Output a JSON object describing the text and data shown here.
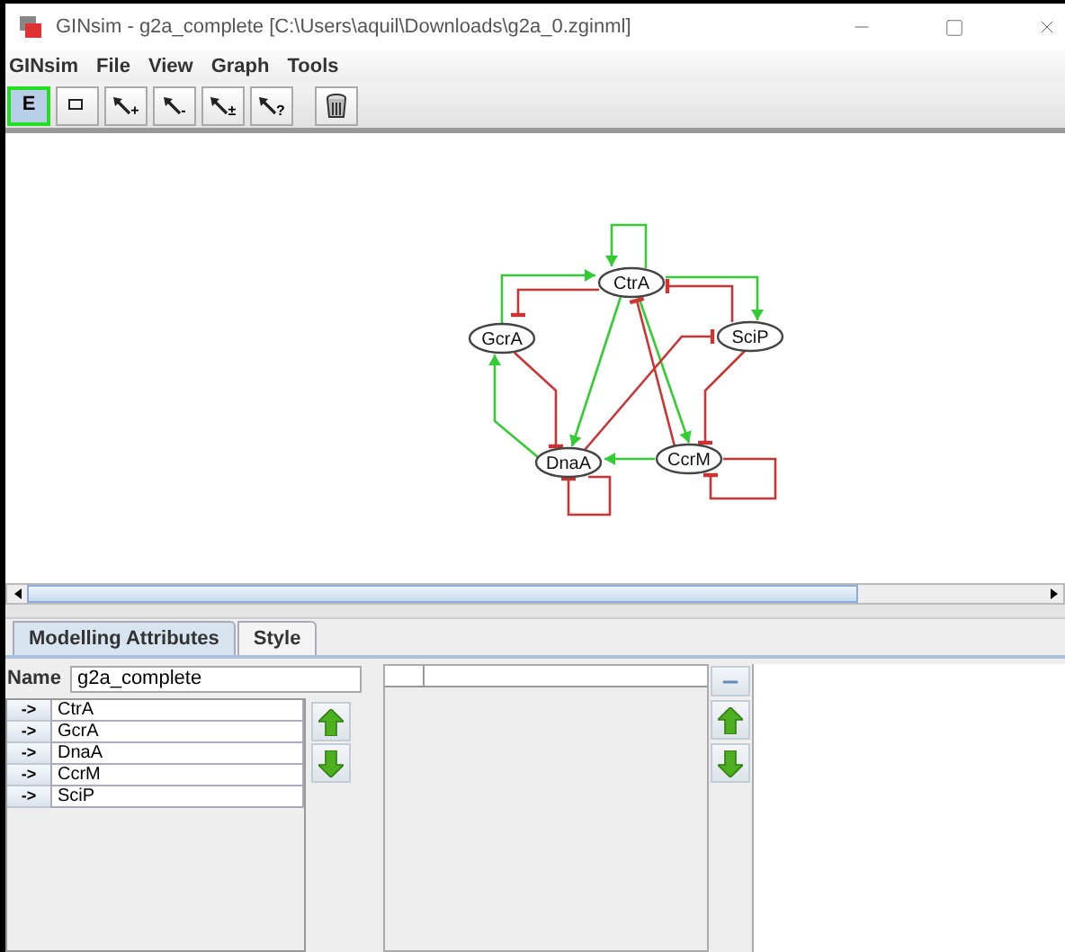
{
  "window": {
    "title": "GINsim - g2a_complete [C:\\Users\\aquil\\Downloads\\g2a_0.zginml]"
  },
  "menu": [
    "GINsim",
    "File",
    "View",
    "Graph",
    "Tools"
  ],
  "toolbar": [
    {
      "kind": "text",
      "label": "E",
      "selected": true
    },
    {
      "kind": "add-node",
      "selected": false
    },
    {
      "kind": "edge",
      "sub": "+",
      "selected": false
    },
    {
      "kind": "edge",
      "sub": "-",
      "selected": false
    },
    {
      "kind": "edge",
      "sub": "±",
      "selected": false
    },
    {
      "kind": "edge",
      "sub": "?",
      "selected": false
    },
    {
      "kind": "delete",
      "selected": false
    }
  ],
  "graph": {
    "nodes": [
      {
        "label": "CtrA"
      },
      {
        "label": "GcrA"
      },
      {
        "label": "SciP"
      },
      {
        "label": "DnaA"
      },
      {
        "label": "CcrM"
      }
    ],
    "edges": [
      {
        "kind": "activation"
      },
      {
        "kind": "activation"
      },
      {
        "kind": "activation"
      },
      {
        "kind": "inhibition"
      },
      {
        "kind": "inhibition"
      },
      {
        "kind": "activation"
      },
      {
        "kind": "activation"
      },
      {
        "kind": "inhibition"
      },
      {
        "kind": "inhibition"
      },
      {
        "kind": "inhibition"
      },
      {
        "kind": "inhibition"
      },
      {
        "kind": "activation"
      },
      {
        "kind": "activation"
      },
      {
        "kind": "inhibition"
      },
      {
        "kind": "inhibition"
      }
    ]
  },
  "tabs": [
    {
      "label": "Modelling Attributes",
      "selected": true
    },
    {
      "label": "Style",
      "selected": false
    }
  ],
  "name_field": {
    "label": "Name",
    "value": "g2a_complete"
  },
  "node_list": [
    {
      "marker": "->",
      "label": "CtrA"
    },
    {
      "marker": "->",
      "label": "GcrA"
    },
    {
      "marker": "->",
      "label": "DnaA"
    },
    {
      "marker": "->",
      "label": "CcrM"
    },
    {
      "marker": "->",
      "label": "SciP"
    }
  ]
}
